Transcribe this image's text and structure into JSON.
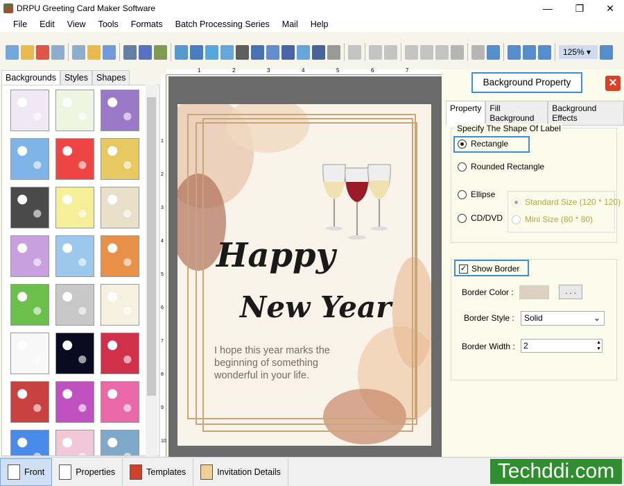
{
  "window": {
    "title": "DRPU Greeting Card Maker Software",
    "controls": [
      "—",
      "❐",
      "✕"
    ]
  },
  "menu": [
    "File",
    "Edit",
    "View",
    "Tools",
    "Formats",
    "Batch Processing Series",
    "Mail",
    "Help"
  ],
  "toolbar": {
    "zoom_value": "125%",
    "icons": [
      "new",
      "open",
      "close",
      "save",
      "save-as",
      "export",
      "print-preview",
      "print",
      "print-multi",
      "background",
      "image",
      "pen",
      "shape",
      "watermark",
      "barcode",
      "text",
      "word-art",
      "signature",
      "email",
      "line",
      "database",
      "undo",
      "redo",
      "cut",
      "copy",
      "paste",
      "delete",
      "bring-front",
      "send-back",
      "grid",
      "actual-size",
      "fit",
      "zoom-in",
      "zoom-out"
    ]
  },
  "left_panel": {
    "tabs": [
      "Backgrounds",
      "Styles",
      "Shapes"
    ],
    "active_tab": "Backgrounds",
    "thumb_colors": [
      [
        "#f0e8f5",
        "#eef5e0",
        "#9a7ac8"
      ],
      [
        "#7fb4e8",
        "#e44",
        "#e8c860"
      ],
      [
        "#4a4a4a",
        "#f5ef9a",
        "#e8e0c8"
      ],
      [
        "#c8a0e0",
        "#9cc8ee",
        "#e89048"
      ],
      [
        "#6ac04a",
        "#c8c8c8",
        "#f5f0e0"
      ],
      [
        "#f8f8f8",
        "#0a0a20",
        "#d0304a"
      ],
      [
        "#c84040",
        "#c050c0",
        "#e868a8"
      ],
      [
        "#4a8ae8",
        "#f0c8d8",
        "#80a8c8"
      ]
    ]
  },
  "ruler": {
    "h": [
      "1",
      "2",
      "3",
      "4",
      "5",
      "6",
      "7"
    ],
    "v": [
      "1",
      "2",
      "3",
      "4",
      "5",
      "6",
      "7",
      "8",
      "9",
      "10"
    ]
  },
  "card": {
    "line1": "Happy",
    "line2": "New Year",
    "message": [
      "I hope this year marks the",
      "beginning of something",
      "wonderful in your life."
    ]
  },
  "right_panel": {
    "title": "Background Property",
    "tabs": [
      "Property",
      "Fill Background",
      "Background Effects"
    ],
    "active_tab": "Property",
    "shape_group": "Specify The Shape Of Label",
    "shapes": [
      {
        "label": "Rectangle",
        "checked": true
      },
      {
        "label": "Rounded Rectangle",
        "checked": false
      },
      {
        "label": "Ellipse",
        "checked": false
      },
      {
        "label": "CD/DVD",
        "checked": false
      }
    ],
    "sizes": [
      {
        "label": "Standard Size (120 * 120)",
        "checked": true
      },
      {
        "label": "Mini Size (80 * 80)",
        "checked": false
      }
    ],
    "show_border": {
      "label": "Show Border",
      "checked": true
    },
    "border_color_label": "Border Color :",
    "border_color": "#ddd2c0",
    "browse_label": ". . .",
    "border_style_label": "Border Style :",
    "border_style": "Solid",
    "border_width_label": "Border Width :",
    "border_width": "2"
  },
  "bottom_tabs": [
    "Front",
    "Properties",
    "Templates",
    "Invitation Details"
  ],
  "brand": "Techddi.com"
}
